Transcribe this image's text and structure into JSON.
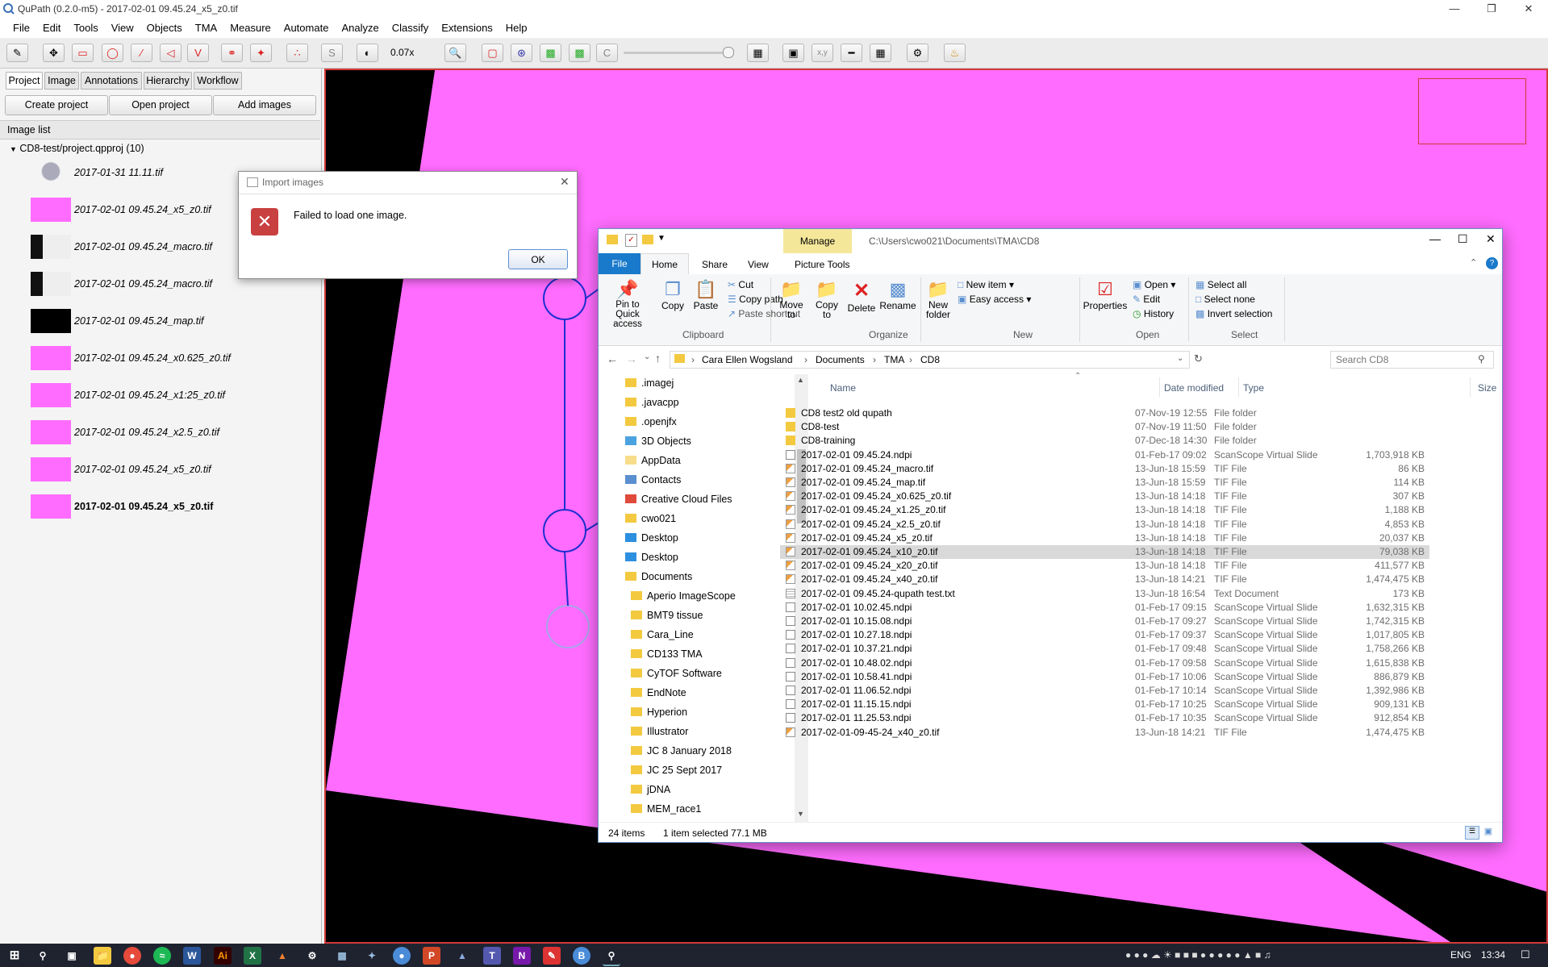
{
  "qupath": {
    "title": "QuPath (0.2.0-m5) - 2017-02-01 09.45.24_x5_z0.tif",
    "menu": [
      "File",
      "Edit",
      "Tools",
      "View",
      "Objects",
      "TMA",
      "Measure",
      "Automate",
      "Analyze",
      "Classify",
      "Extensions",
      "Help"
    ],
    "zoom": "0.07x",
    "xy_label": "x,y",
    "panel_tabs": [
      "Project",
      "Image",
      "Annotations",
      "Hierarchy",
      "Workflow"
    ],
    "buttons": {
      "create": "Create project",
      "open": "Open project",
      "add": "Add images"
    },
    "image_list_title": "Image list",
    "project_node": "CD8-test/project.qpproj (10)",
    "images": [
      {
        "name": "2017-01-31 11.11.tif",
        "thumb": "tissue",
        "bold": false
      },
      {
        "name": "2017-02-01 09.45.24_x5_z0.tif",
        "thumb": "pink",
        "bold": false
      },
      {
        "name": "2017-02-01 09.45.24_macro.tif",
        "thumb": "macro",
        "bold": false
      },
      {
        "name": "2017-02-01 09.45.24_macro.tif",
        "thumb": "macro",
        "bold": false
      },
      {
        "name": "2017-02-01 09.45.24_map.tif",
        "thumb": "black",
        "bold": false
      },
      {
        "name": "2017-02-01 09.45.24_x0.625_z0.tif",
        "thumb": "pink",
        "bold": false
      },
      {
        "name": "2017-02-01 09.45.24_x1:25_z0.tif",
        "thumb": "pink",
        "bold": false
      },
      {
        "name": "2017-02-01 09.45.24_x2.5_z0.tif",
        "thumb": "pink",
        "bold": false
      },
      {
        "name": "2017-02-01 09.45.24_x5_z0.tif",
        "thumb": "pink",
        "bold": false
      },
      {
        "name": "2017-02-01 09.45.24_x5_z0.tif",
        "thumb": "pink",
        "bold": true
      }
    ]
  },
  "dialog": {
    "title": "Import images",
    "message": "Failed to load one image.",
    "ok": "OK"
  },
  "explorer": {
    "manage_tab": "Manage",
    "path_title": "C:\\Users\\cwo021\\Documents\\TMA\\CD8",
    "ribbon_tabs": [
      "File",
      "Home",
      "Share",
      "View",
      "Picture Tools"
    ],
    "clipboard": {
      "pin": "Pin to Quick access",
      "copy": "Copy",
      "paste": "Paste",
      "cut": "Cut",
      "copy_path": "Copy path",
      "paste_shortcut": "Paste shortcut",
      "group": "Clipboard"
    },
    "organize": {
      "move": "Move to",
      "copy_to": "Copy to",
      "delete": "Delete",
      "rename": "Rename",
      "group": "Organize"
    },
    "new": {
      "folder": "New folder",
      "item": "New item",
      "easy": "Easy access",
      "group": "New"
    },
    "open": {
      "properties": "Properties",
      "open": "Open",
      "edit": "Edit",
      "history": "History",
      "group": "Open"
    },
    "select": {
      "all": "Select all",
      "none": "Select none",
      "invert": "Invert selection",
      "group": "Select"
    },
    "breadcrumb": [
      "Cara Ellen Wogsland",
      "Documents",
      "TMA",
      "CD8"
    ],
    "search_placeholder": "Search CD8",
    "columns": {
      "name": "Name",
      "date": "Date modified",
      "type": "Type",
      "size": "Size"
    },
    "tree": [
      {
        "label": ".imagej",
        "icon": "folder",
        "indent": 1
      },
      {
        "label": ".javacpp",
        "icon": "folder",
        "indent": 1
      },
      {
        "label": ".openjfx",
        "icon": "folder",
        "indent": 1
      },
      {
        "label": "3D Objects",
        "icon": "3d",
        "indent": 1
      },
      {
        "label": "AppData",
        "icon": "folder-light",
        "indent": 1
      },
      {
        "label": "Contacts",
        "icon": "contacts",
        "indent": 1
      },
      {
        "label": "Creative Cloud Files",
        "icon": "cc",
        "indent": 1
      },
      {
        "label": "cwo021",
        "icon": "user",
        "indent": 1
      },
      {
        "label": "Desktop",
        "icon": "desktop",
        "indent": 1
      },
      {
        "label": "Desktop",
        "icon": "desktop",
        "indent": 1
      },
      {
        "label": "Documents",
        "icon": "folder",
        "indent": 1
      },
      {
        "label": "Aperio ImageScope",
        "icon": "folder",
        "indent": 2
      },
      {
        "label": "BMT9 tissue",
        "icon": "folder",
        "indent": 2
      },
      {
        "label": "Cara_Line",
        "icon": "folder",
        "indent": 2
      },
      {
        "label": "CD133 TMA",
        "icon": "folder",
        "indent": 2
      },
      {
        "label": "CyTOF Software",
        "icon": "folder",
        "indent": 2
      },
      {
        "label": "EndNote",
        "icon": "folder",
        "indent": 2
      },
      {
        "label": "Hyperion",
        "icon": "folder",
        "indent": 2
      },
      {
        "label": "Illustrator",
        "icon": "folder",
        "indent": 2
      },
      {
        "label": "JC 8 January 2018",
        "icon": "folder",
        "indent": 2
      },
      {
        "label": "JC 25 Sept 2017",
        "icon": "folder",
        "indent": 2
      },
      {
        "label": "jDNA",
        "icon": "folder",
        "indent": 2
      },
      {
        "label": "MEM_race1",
        "icon": "folder",
        "indent": 2
      }
    ],
    "files": [
      {
        "name": "CD8 test2 old qupath",
        "date": "07-Nov-19 12:55",
        "type": "File folder",
        "size": "",
        "icon": "folder"
      },
      {
        "name": "CD8-test",
        "date": "07-Nov-19 11:50",
        "type": "File folder",
        "size": "",
        "icon": "folder"
      },
      {
        "name": "CD8-training",
        "date": "07-Dec-18 14:30",
        "type": "File folder",
        "size": "",
        "icon": "folder"
      },
      {
        "name": "2017-02-01 09.45.24.ndpi",
        "date": "01-Feb-17 09:02",
        "type": "ScanScope Virtual Slide",
        "size": "1,703,918 KB",
        "icon": "doc"
      },
      {
        "name": "2017-02-01 09.45.24_macro.tif",
        "date": "13-Jun-18 15:59",
        "type": "TIF File",
        "size": "86 KB",
        "icon": "img"
      },
      {
        "name": "2017-02-01 09.45.24_map.tif",
        "date": "13-Jun-18 15:59",
        "type": "TIF File",
        "size": "114 KB",
        "icon": "img"
      },
      {
        "name": "2017-02-01 09.45.24_x0.625_z0.tif",
        "date": "13-Jun-18 14:18",
        "type": "TIF File",
        "size": "307 KB",
        "icon": "img"
      },
      {
        "name": "2017-02-01 09.45.24_x1.25_z0.tif",
        "date": "13-Jun-18 14:18",
        "type": "TIF File",
        "size": "1,188 KB",
        "icon": "img"
      },
      {
        "name": "2017-02-01 09.45.24_x2.5_z0.tif",
        "date": "13-Jun-18 14:18",
        "type": "TIF File",
        "size": "4,853 KB",
        "icon": "img"
      },
      {
        "name": "2017-02-01 09.45.24_x5_z0.tif",
        "date": "13-Jun-18 14:18",
        "type": "TIF File",
        "size": "20,037 KB",
        "icon": "img"
      },
      {
        "name": "2017-02-01 09.45.24_x10_z0.tif",
        "date": "13-Jun-18 14:18",
        "type": "TIF File",
        "size": "79,038 KB",
        "icon": "img",
        "selected": true
      },
      {
        "name": "2017-02-01 09.45.24_x20_z0.tif",
        "date": "13-Jun-18 14:18",
        "type": "TIF File",
        "size": "411,577 KB",
        "icon": "img"
      },
      {
        "name": "2017-02-01 09.45.24_x40_z0.tif",
        "date": "13-Jun-18 14:21",
        "type": "TIF File",
        "size": "1,474,475 KB",
        "icon": "img"
      },
      {
        "name": "2017-02-01 09.45.24-qupath test.txt",
        "date": "13-Jun-18 16:54",
        "type": "Text Document",
        "size": "173 KB",
        "icon": "txt"
      },
      {
        "name": "2017-02-01 10.02.45.ndpi",
        "date": "01-Feb-17 09:15",
        "type": "ScanScope Virtual Slide",
        "size": "1,632,315 KB",
        "icon": "doc"
      },
      {
        "name": "2017-02-01 10.15.08.ndpi",
        "date": "01-Feb-17 09:27",
        "type": "ScanScope Virtual Slide",
        "size": "1,742,315 KB",
        "icon": "doc"
      },
      {
        "name": "2017-02-01 10.27.18.ndpi",
        "date": "01-Feb-17 09:37",
        "type": "ScanScope Virtual Slide",
        "size": "1,017,805 KB",
        "icon": "doc"
      },
      {
        "name": "2017-02-01 10.37.21.ndpi",
        "date": "01-Feb-17 09:48",
        "type": "ScanScope Virtual Slide",
        "size": "1,758,266 KB",
        "icon": "doc"
      },
      {
        "name": "2017-02-01 10.48.02.ndpi",
        "date": "01-Feb-17 09:58",
        "type": "ScanScope Virtual Slide",
        "size": "1,615,838 KB",
        "icon": "doc"
      },
      {
        "name": "2017-02-01 10.58.41.ndpi",
        "date": "01-Feb-17 10:06",
        "type": "ScanScope Virtual Slide",
        "size": "886,879 KB",
        "icon": "doc"
      },
      {
        "name": "2017-02-01 11.06.52.ndpi",
        "date": "01-Feb-17 10:14",
        "type": "ScanScope Virtual Slide",
        "size": "1,392,986 KB",
        "icon": "doc"
      },
      {
        "name": "2017-02-01 11.15.15.ndpi",
        "date": "01-Feb-17 10:25",
        "type": "ScanScope Virtual Slide",
        "size": "909,131 KB",
        "icon": "doc"
      },
      {
        "name": "2017-02-01 11.25.53.ndpi",
        "date": "01-Feb-17 10:35",
        "type": "ScanScope Virtual Slide",
        "size": "912,854 KB",
        "icon": "doc"
      },
      {
        "name": "2017-02-01-09-45-24_x40_z0.tif",
        "date": "13-Jun-18 14:21",
        "type": "TIF File",
        "size": "1,474,475 KB",
        "icon": "img"
      }
    ],
    "status": {
      "items": "24 items",
      "selected": "1 item selected  77.1 MB"
    }
  },
  "taskbar": {
    "lang": "ENG",
    "time": "13:34"
  },
  "colors": {
    "pink": "#ff6cff",
    "accent": "#1979ca",
    "ribbon_manage": "#f5e79a",
    "error": "#c42b1c"
  }
}
